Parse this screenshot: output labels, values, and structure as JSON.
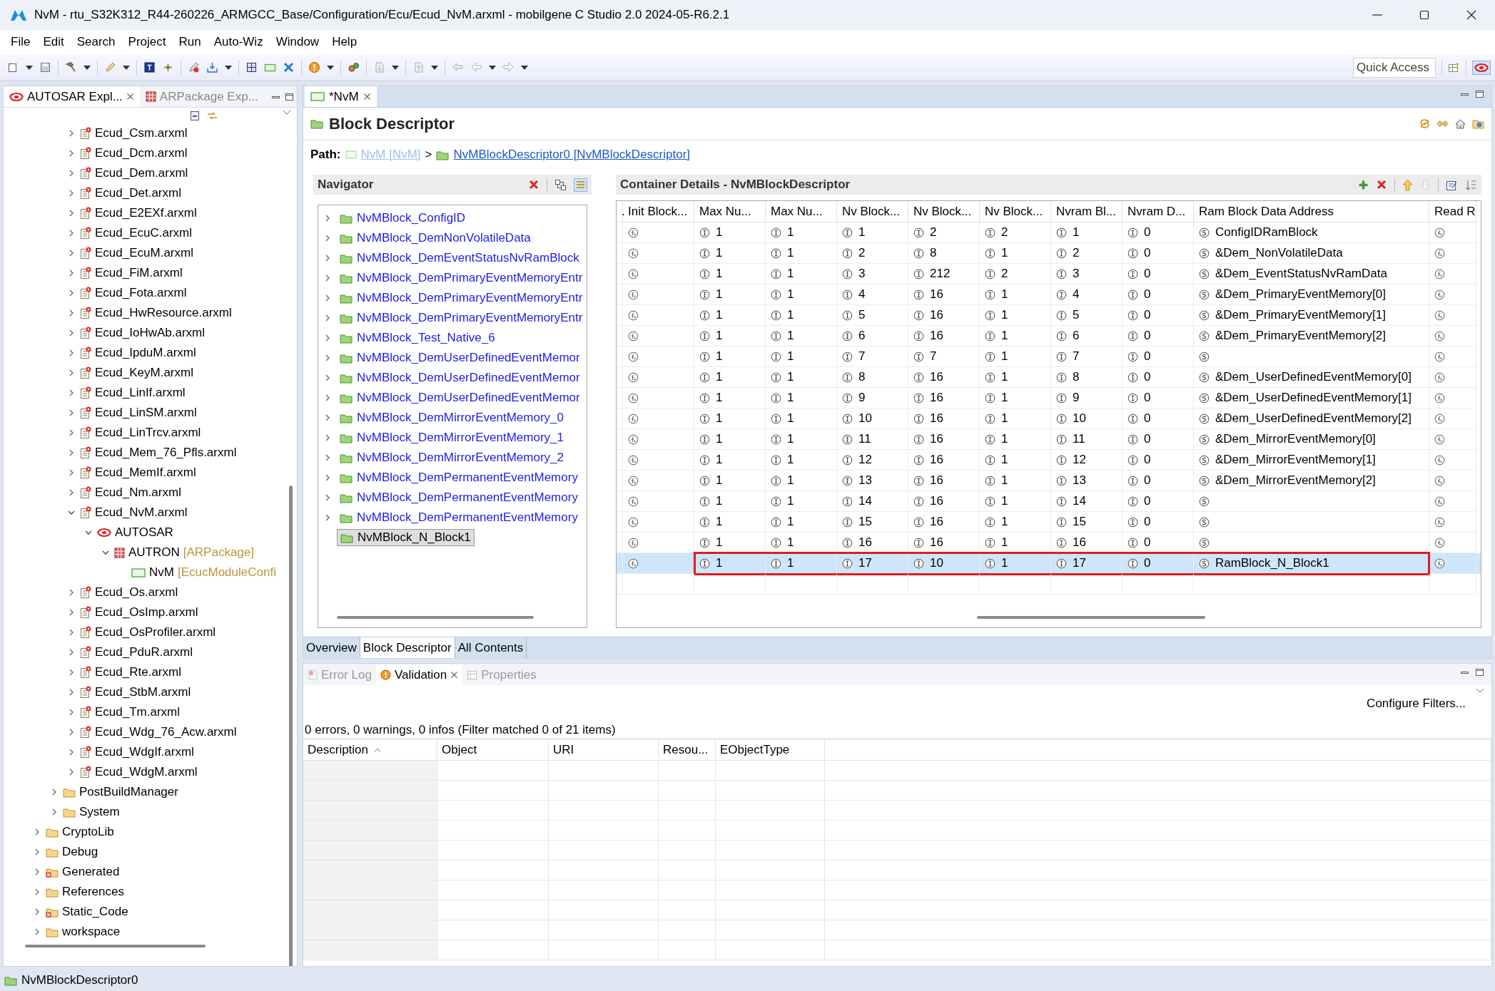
{
  "window": {
    "title": "NvM - rtu_S32K312_R44-260226_ARMGCC_Base/Configuration/Ecu/Ecud_NvM.arxml - mobilgene C Studio 2.0 2024-05-R6.2.1"
  },
  "menu": [
    "File",
    "Edit",
    "Search",
    "Project",
    "Run",
    "Auto-Wiz",
    "Window",
    "Help"
  ],
  "quick_access": {
    "placeholder": "Quick Access"
  },
  "explorer": {
    "tabs": [
      {
        "label": "AUTOSAR Expl...",
        "selected": true
      },
      {
        "label": "ARPackage Exp...",
        "selected": false
      }
    ],
    "tree": [
      {
        "children": [
          {
            "children": [
              {
                "label": "Ecud_Csm.arxml",
                "kind": "file",
                "expanded": false
              },
              {
                "label": "Ecud_Dcm.arxml",
                "kind": "file",
                "expanded": false
              },
              {
                "label": "Ecud_Dem.arxml",
                "kind": "file",
                "expanded": false
              },
              {
                "label": "Ecud_Det.arxml",
                "kind": "file",
                "expanded": false
              },
              {
                "label": "Ecud_E2EXf.arxml",
                "kind": "file",
                "expanded": false
              },
              {
                "label": "Ecud_EcuC.arxml",
                "kind": "file",
                "expanded": false
              },
              {
                "label": "Ecud_EcuM.arxml",
                "kind": "file",
                "expanded": false
              },
              {
                "label": "Ecud_FiM.arxml",
                "kind": "file",
                "expanded": false
              },
              {
                "label": "Ecud_Fota.arxml",
                "kind": "file",
                "expanded": false
              },
              {
                "label": "Ecud_HwResource.arxml",
                "kind": "file",
                "expanded": false
              },
              {
                "label": "Ecud_IoHwAb.arxml",
                "kind": "file",
                "expanded": false
              },
              {
                "label": "Ecud_IpduM.arxml",
                "kind": "file",
                "expanded": false
              },
              {
                "label": "Ecud_KeyM.arxml",
                "kind": "file",
                "expanded": false
              },
              {
                "label": "Ecud_LinIf.arxml",
                "kind": "file",
                "expanded": false
              },
              {
                "label": "Ecud_LinSM.arxml",
                "kind": "file",
                "expanded": false
              },
              {
                "label": "Ecud_LinTrcv.arxml",
                "kind": "file",
                "expanded": false
              },
              {
                "label": "Ecud_Mem_76_Pfls.arxml",
                "kind": "file",
                "expanded": false
              },
              {
                "label": "Ecud_MemIf.arxml",
                "kind": "file",
                "expanded": false
              },
              {
                "label": "Ecud_Nm.arxml",
                "kind": "file",
                "expanded": false
              },
              {
                "label": "Ecud_NvM.arxml",
                "kind": "file",
                "expanded": true,
                "children": [
                  {
                    "label": "AUTOSAR",
                    "kind": "autosar",
                    "expanded": true,
                    "children": [
                      {
                        "label": "AUTRON",
                        "suffix": "[ARPackage]",
                        "kind": "package",
                        "expanded": true,
                        "children": [
                          {
                            "label": "NvM",
                            "suffix": "[EcucModuleConfi",
                            "kind": "module"
                          }
                        ]
                      }
                    ]
                  }
                ]
              },
              {
                "label": "Ecud_Os.arxml",
                "kind": "file",
                "expanded": false
              },
              {
                "label": "Ecud_OsImp.arxml",
                "kind": "file",
                "expanded": false
              },
              {
                "label": "Ecud_OsProfiler.arxml",
                "kind": "file",
                "expanded": false
              },
              {
                "label": "Ecud_PduR.arxml",
                "kind": "file",
                "expanded": false
              },
              {
                "label": "Ecud_Rte.arxml",
                "kind": "file",
                "expanded": false
              },
              {
                "label": "Ecud_StbM.arxml",
                "kind": "file",
                "expanded": false
              },
              {
                "label": "Ecud_Tm.arxml",
                "kind": "file",
                "expanded": false
              },
              {
                "label": "Ecud_Wdg_76_Acw.arxml",
                "kind": "file",
                "expanded": false
              },
              {
                "label": "Ecud_WdgIf.arxml",
                "kind": "file",
                "expanded": false
              },
              {
                "label": "Ecud_WdgM.arxml",
                "kind": "file",
                "expanded": false
              }
            ]
          },
          {
            "label": "PostBuildManager",
            "kind": "folder",
            "expanded": false
          },
          {
            "label": "System",
            "kind": "folder",
            "expanded": false
          }
        ]
      },
      {
        "label": "CryptoLib",
        "kind": "folder",
        "expanded": false
      },
      {
        "label": "Debug",
        "kind": "folder",
        "expanded": false
      },
      {
        "label": "Generated",
        "kind": "error-folder",
        "expanded": false
      },
      {
        "label": "References",
        "kind": "folder",
        "expanded": false
      },
      {
        "label": "Static_Code",
        "kind": "error-folder",
        "expanded": false
      },
      {
        "label": "workspace",
        "kind": "folder",
        "expanded": false
      }
    ]
  },
  "editor": {
    "tab": {
      "label": "*NvM"
    },
    "heading": "Block Descriptor",
    "path": {
      "label": "Path:",
      "separator": ">",
      "items": [
        {
          "text": "NvM [NvM]",
          "disabled": true
        },
        {
          "text": "NvMBlockDescriptor0 [NvMBlockDescriptor]",
          "disabled": false
        }
      ]
    },
    "navigator": {
      "title": "Navigator",
      "items": [
        {
          "label": "NvMBlock_ConfigID",
          "selected": false,
          "expanded": false
        },
        {
          "label": "NvMBlock_DemNonVolatileData",
          "selected": false,
          "expanded": false
        },
        {
          "label": "NvMBlock_DemEventStatusNvRamBlock",
          "selected": false,
          "expanded": false
        },
        {
          "label": "NvMBlock_DemPrimaryEventMemoryEntr",
          "selected": false,
          "expanded": false
        },
        {
          "label": "NvMBlock_DemPrimaryEventMemoryEntr",
          "selected": false,
          "expanded": false
        },
        {
          "label": "NvMBlock_DemPrimaryEventMemoryEntr",
          "selected": false,
          "expanded": false
        },
        {
          "label": "NvMBlock_Test_Native_6",
          "selected": false,
          "expanded": false
        },
        {
          "label": "NvMBlock_DemUserDefinedEventMemor",
          "selected": false,
          "expanded": false
        },
        {
          "label": "NvMBlock_DemUserDefinedEventMemor",
          "selected": false,
          "expanded": false
        },
        {
          "label": "NvMBlock_DemUserDefinedEventMemor",
          "selected": false,
          "expanded": false
        },
        {
          "label": "NvMBlock_DemMirrorEventMemory_0",
          "selected": false,
          "expanded": false
        },
        {
          "label": "NvMBlock_DemMirrorEventMemory_1",
          "selected": false,
          "expanded": false
        },
        {
          "label": "NvMBlock_DemMirrorEventMemory_2",
          "selected": false,
          "expanded": false
        },
        {
          "label": "NvMBlock_DemPermanentEventMemory",
          "selected": false,
          "expanded": false
        },
        {
          "label": "NvMBlock_DemPermanentEventMemory",
          "selected": false,
          "expanded": false
        },
        {
          "label": "NvMBlock_DemPermanentEventMemory",
          "selected": false,
          "expanded": false
        },
        {
          "label": "NvMBlock_N_Block1",
          "selected": true
        }
      ]
    },
    "details": {
      "title": "Container Details - NvMBlockDescriptor",
      "columns": [
        {
          "label": ".",
          "kind": "blank"
        },
        {
          "label": "Init Block...",
          "kind": "function"
        },
        {
          "label": "Max Nu...",
          "kind": "integer"
        },
        {
          "label": "Max Nu...",
          "kind": "integer"
        },
        {
          "label": "Nv Block...",
          "kind": "integer"
        },
        {
          "label": "Nv Block...",
          "kind": "integer"
        },
        {
          "label": "Nv Block...",
          "kind": "integer"
        },
        {
          "label": "Nvram Bl...",
          "kind": "integer"
        },
        {
          "label": "Nvram D...",
          "kind": "integer"
        },
        {
          "label": "Ram Block Data Address",
          "kind": "string"
        },
        {
          "label": "Read R",
          "kind": "function"
        }
      ],
      "rows": [
        {
          "values": [
            "1",
            "1",
            "1",
            "2",
            "2",
            "1",
            "0"
          ],
          "address": "ConfigIDRamBlock",
          "selected": false,
          "highlighted": false
        },
        {
          "values": [
            "1",
            "1",
            "2",
            "8",
            "1",
            "2",
            "0"
          ],
          "address": "&Dem_NonVolatileData",
          "selected": false,
          "highlighted": false
        },
        {
          "values": [
            "1",
            "1",
            "3",
            "212",
            "2",
            "3",
            "0"
          ],
          "address": "&Dem_EventStatusNvRamData",
          "selected": false,
          "highlighted": false
        },
        {
          "values": [
            "1",
            "1",
            "4",
            "16",
            "1",
            "4",
            "0"
          ],
          "address": "&Dem_PrimaryEventMemory[0]",
          "selected": false,
          "highlighted": false
        },
        {
          "values": [
            "1",
            "1",
            "5",
            "16",
            "1",
            "5",
            "0"
          ],
          "address": "&Dem_PrimaryEventMemory[1]",
          "selected": false,
          "highlighted": false
        },
        {
          "values": [
            "1",
            "1",
            "6",
            "16",
            "1",
            "6",
            "0"
          ],
          "address": "&Dem_PrimaryEventMemory[2]",
          "selected": false,
          "highlighted": false
        },
        {
          "values": [
            "1",
            "1",
            "7",
            "7",
            "1",
            "7",
            "0"
          ],
          "selected": false,
          "highlighted": false
        },
        {
          "values": [
            "1",
            "1",
            "8",
            "16",
            "1",
            "8",
            "0"
          ],
          "address": "&Dem_UserDefinedEventMemory[0]",
          "selected": false,
          "highlighted": false
        },
        {
          "values": [
            "1",
            "1",
            "9",
            "16",
            "1",
            "9",
            "0"
          ],
          "address": "&Dem_UserDefinedEventMemory[1]",
          "selected": false,
          "highlighted": false
        },
        {
          "values": [
            "1",
            "1",
            "10",
            "16",
            "1",
            "10",
            "0"
          ],
          "address": "&Dem_UserDefinedEventMemory[2]",
          "selected": false,
          "highlighted": false
        },
        {
          "values": [
            "1",
            "1",
            "11",
            "16",
            "1",
            "11",
            "0"
          ],
          "address": "&Dem_MirrorEventMemory[0]",
          "selected": false,
          "highlighted": false
        },
        {
          "values": [
            "1",
            "1",
            "12",
            "16",
            "1",
            "12",
            "0"
          ],
          "address": "&Dem_MirrorEventMemory[1]",
          "selected": false,
          "highlighted": false
        },
        {
          "values": [
            "1",
            "1",
            "13",
            "16",
            "1",
            "13",
            "0"
          ],
          "address": "&Dem_MirrorEventMemory[2]",
          "selected": false,
          "highlighted": false
        },
        {
          "values": [
            "1",
            "1",
            "14",
            "16",
            "1",
            "14",
            "0"
          ],
          "selected": false,
          "highlighted": false
        },
        {
          "values": [
            "1",
            "1",
            "15",
            "16",
            "1",
            "15",
            "0"
          ],
          "selected": false,
          "highlighted": false
        },
        {
          "values": [
            "1",
            "1",
            "16",
            "16",
            "1",
            "16",
            "0"
          ],
          "selected": false,
          "highlighted": false
        },
        {
          "values": [
            "1",
            "1",
            "17",
            "10",
            "1",
            "17",
            "0"
          ],
          "address": "RamBlock_N_Block1",
          "selected": true,
          "highlighted": true
        }
      ]
    },
    "page_tabs": [
      {
        "label": "Overview",
        "selected": false
      },
      {
        "label": "Block Descriptor",
        "selected": true
      },
      {
        "label": "All Contents",
        "selected": false
      }
    ]
  },
  "problems": {
    "tabs": [
      {
        "label": "Error Log",
        "selected": false
      },
      {
        "label": "Validation",
        "selected": true
      },
      {
        "label": "Properties",
        "selected": false
      }
    ],
    "filter_link": "Configure Filters...",
    "summary": "0 errors, 0 warnings, 0 infos (Filter matched 0 of 21 items)",
    "columns": [
      "Description",
      "Object",
      "URI",
      "Resou...",
      "EObjectType"
    ]
  },
  "status_bar": {
    "text": "NvMBlockDescriptor0"
  }
}
